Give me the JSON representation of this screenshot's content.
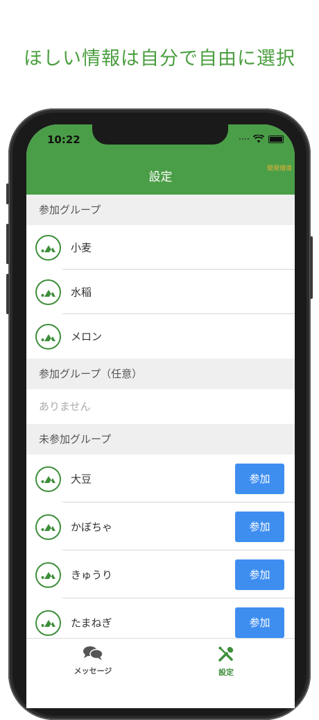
{
  "headline": "ほしい情報は自分で自由に選択",
  "status_bar": {
    "time": "10:22"
  },
  "header": {
    "title": "設定",
    "env_label": "開発環境"
  },
  "sections": {
    "joined": "参加グループ",
    "joined_optional": "参加グループ（任意）",
    "not_joined": "未参加グループ"
  },
  "joined_groups": [
    {
      "name": "小麦"
    },
    {
      "name": "水稲"
    },
    {
      "name": "メロン"
    }
  ],
  "optional_empty": "ありません",
  "not_joined_groups": [
    {
      "name": "大豆",
      "button": "参加"
    },
    {
      "name": "かぼちゃ",
      "button": "参加"
    },
    {
      "name": "きゅうり",
      "button": "参加"
    },
    {
      "name": "たまねぎ",
      "button": "参加"
    }
  ],
  "tabs": {
    "messages": "メッセージ",
    "settings": "設定"
  },
  "colors": {
    "brand_green": "#4a9e47",
    "join_button_blue": "#3e8ef0",
    "env_label_yellow": "#e8b03a"
  },
  "icons": {
    "group_avatar": "logo-icon",
    "messages_tab": "chat-bubbles-icon",
    "settings_tab": "tools-icon"
  }
}
